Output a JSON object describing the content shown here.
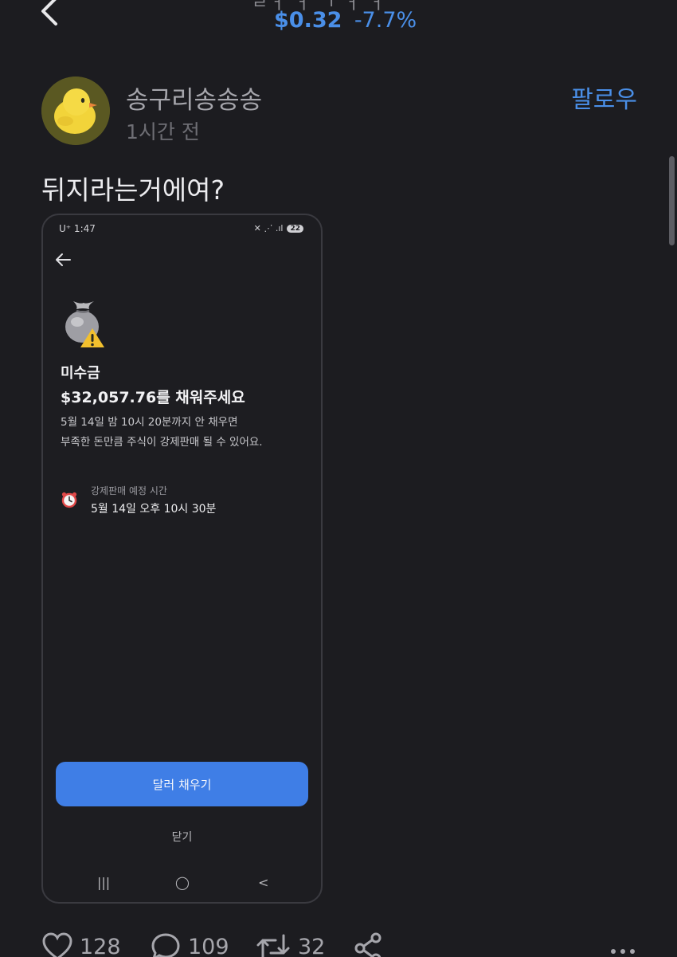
{
  "header": {
    "title_cut": "ㄹㅓ ㅓ ㄱ ㅓ ㅓ",
    "price": "$0.32",
    "change": "-7.7%"
  },
  "post": {
    "username": "송구리송송송",
    "time": "1시간 전",
    "follow_label": "팔로우",
    "text": "뒤지라는거에여?"
  },
  "screenshot": {
    "status_carrier": "U⁺ 1:47",
    "status_icons": "✕ ⋰ .ıl",
    "battery": "22",
    "title": "미수금",
    "amount": "$32,057.76를 채워주세요",
    "desc_line1": "5월 14일 밤 10시 20분까지 안 채우면",
    "desc_line2": "부족한 돈만큼 주식이 강제판매 될 수 있어요.",
    "schedule_label": "강제판매 예정 시간",
    "schedule_time": "5월 14일 오후 10시 30분",
    "primary_button": "달러 채우기",
    "close_label": "닫기",
    "nav_recent": "|||",
    "nav_home": "◯",
    "nav_back": "<"
  },
  "actions": {
    "likes": "128",
    "comments": "109",
    "reposts": "32"
  },
  "colors": {
    "accent": "#4a8fe8",
    "background": "#1c1c20",
    "button": "#3f7ee6"
  }
}
